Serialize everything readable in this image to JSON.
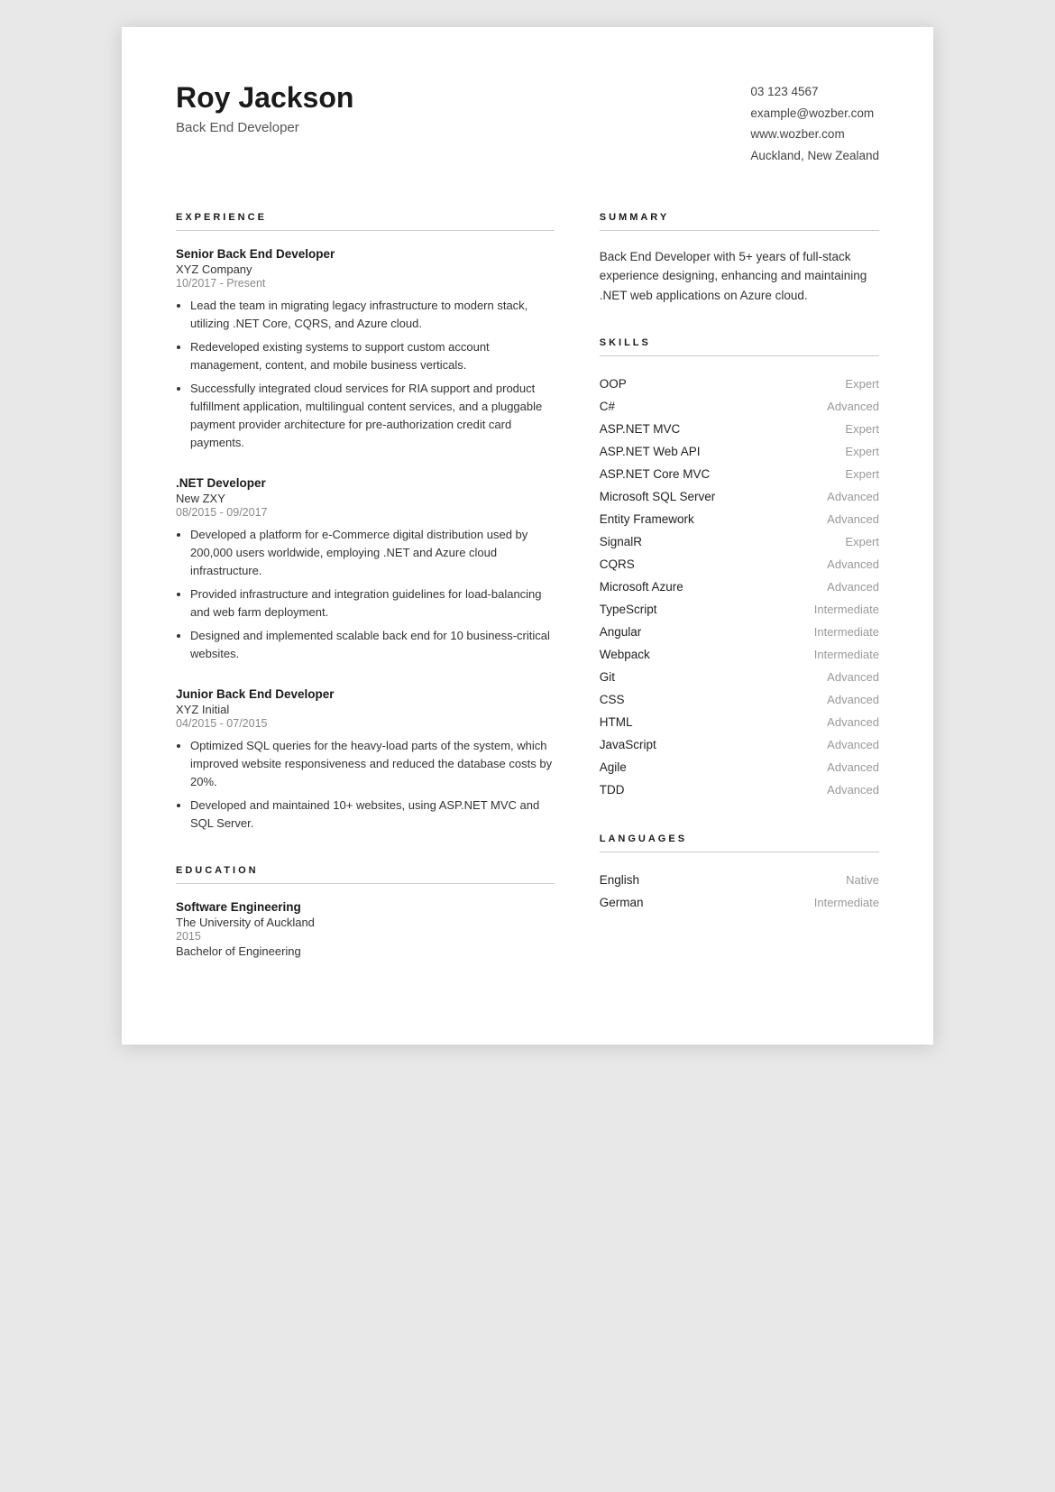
{
  "header": {
    "name": "Roy Jackson",
    "title": "Back End Developer",
    "phone": "03 123 4567",
    "email": "example@wozber.com",
    "website": "www.wozber.com",
    "location": "Auckland, New Zealand"
  },
  "experience": {
    "section_title": "EXPERIENCE",
    "jobs": [
      {
        "title": "Senior Back End Developer",
        "company": "XYZ Company",
        "dates": "10/2017 - Present",
        "bullets": [
          "Lead the team in migrating legacy infrastructure to modern stack, utilizing .NET Core, CQRS, and Azure cloud.",
          "Redeveloped existing systems to support custom account management, content, and mobile business verticals.",
          "Successfully integrated cloud services for RIA support and product fulfillment application, multilingual content services, and a pluggable payment provider architecture for pre-authorization credit card payments."
        ]
      },
      {
        "title": ".NET Developer",
        "company": "New ZXY",
        "dates": "08/2015 - 09/2017",
        "bullets": [
          "Developed a platform for e-Commerce digital distribution used by 200,000 users worldwide, employing .NET and Azure cloud infrastructure.",
          "Provided infrastructure and integration guidelines for load-balancing and web farm deployment.",
          "Designed and implemented scalable back end for 10 business-critical websites."
        ]
      },
      {
        "title": "Junior Back End Developer",
        "company": "XYZ Initial",
        "dates": "04/2015 - 07/2015",
        "bullets": [
          "Optimized SQL queries for the heavy-load parts of the system, which improved website responsiveness and reduced the database costs by 20%.",
          "Developed and maintained 10+ websites, using ASP.NET MVC and SQL Server."
        ]
      }
    ]
  },
  "education": {
    "section_title": "EDUCATION",
    "entries": [
      {
        "degree": "Software Engineering",
        "school": "The University of Auckland",
        "year": "2015",
        "field": "Bachelor of Engineering"
      }
    ]
  },
  "summary": {
    "section_title": "SUMMARY",
    "text": "Back End Developer with 5+ years of full-stack experience designing, enhancing and maintaining .NET web applications on Azure cloud."
  },
  "skills": {
    "section_title": "SKILLS",
    "items": [
      {
        "name": "OOP",
        "level": "Expert"
      },
      {
        "name": "C#",
        "level": "Advanced"
      },
      {
        "name": "ASP.NET MVC",
        "level": "Expert"
      },
      {
        "name": "ASP.NET Web API",
        "level": "Expert"
      },
      {
        "name": "ASP.NET Core MVC",
        "level": "Expert"
      },
      {
        "name": "Microsoft SQL Server",
        "level": "Advanced"
      },
      {
        "name": "Entity Framework",
        "level": "Advanced"
      },
      {
        "name": "SignalR",
        "level": "Expert"
      },
      {
        "name": "CQRS",
        "level": "Advanced"
      },
      {
        "name": "Microsoft Azure",
        "level": "Advanced"
      },
      {
        "name": "TypeScript",
        "level": "Intermediate"
      },
      {
        "name": "Angular",
        "level": "Intermediate"
      },
      {
        "name": "Webpack",
        "level": "Intermediate"
      },
      {
        "name": "Git",
        "level": "Advanced"
      },
      {
        "name": "CSS",
        "level": "Advanced"
      },
      {
        "name": "HTML",
        "level": "Advanced"
      },
      {
        "name": "JavaScript",
        "level": "Advanced"
      },
      {
        "name": "Agile",
        "level": "Advanced"
      },
      {
        "name": "TDD",
        "level": "Advanced"
      }
    ]
  },
  "languages": {
    "section_title": "LANGUAGES",
    "items": [
      {
        "name": "English",
        "level": "Native"
      },
      {
        "name": "German",
        "level": "Intermediate"
      }
    ]
  }
}
